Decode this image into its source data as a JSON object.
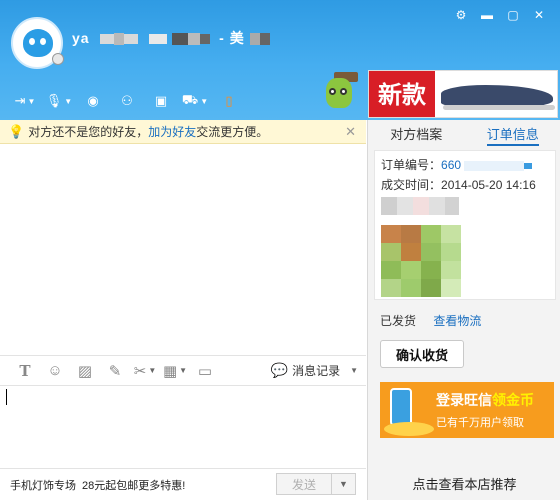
{
  "header": {
    "contact_name_prefix": "ya",
    "contact_name_suffix": "- 美",
    "window_controls": [
      "gear-icon",
      "minimize-icon",
      "maximize-icon",
      "close-icon"
    ]
  },
  "toolbar": {
    "items": [
      "file-transfer-icon",
      "voice-icon",
      "video-icon",
      "add-contact-icon",
      "remote-assist-icon",
      "app-icon",
      "phone-transfer-icon"
    ]
  },
  "ad": {
    "text": "新款"
  },
  "tip": {
    "before": "对方还不是您的好友，",
    "link": "加为好友",
    "after": "交流更方便。"
  },
  "input_toolbar": {
    "items": [
      "font-icon",
      "emoji-icon",
      "image-icon",
      "edit-icon",
      "screenshot-icon",
      "table-icon",
      "shake-icon"
    ],
    "record_label": "消息记录"
  },
  "bottom": {
    "promo_title": "手机灯饰专场",
    "promo_text": "28元起包邮更多特惠!",
    "send_label": "发送"
  },
  "right_panel": {
    "tabs": [
      {
        "label": "对方档案",
        "active": false
      },
      {
        "label": "订单信息",
        "active": true
      }
    ],
    "order": {
      "number_label": "订单编号：",
      "number_value": "660",
      "time_label": "成交时间：",
      "time_value": "2014-05-20 14:16"
    },
    "status": "已发货",
    "logistics_link": "查看物流",
    "confirm_button": "确认收货",
    "promo_line1_a": "登录旺信",
    "promo_line1_b": "领金币",
    "promo_line2": "已有千万用户领取",
    "store_recommend": "点击查看本店推荐"
  },
  "colors": {
    "header_blue": "#46aef0",
    "link_blue": "#1a6fc0",
    "promo_orange": "#f79c1e",
    "ad_red": "#d81e26"
  }
}
